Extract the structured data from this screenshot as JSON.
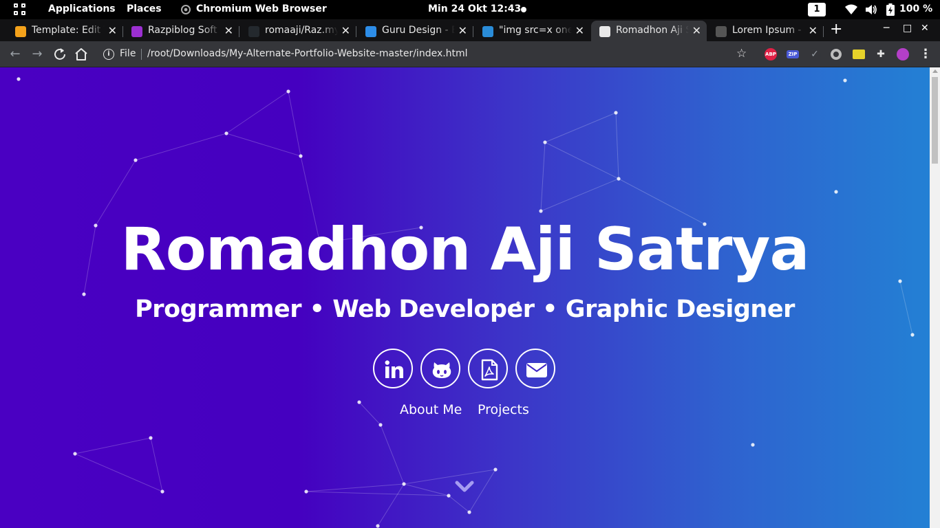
{
  "system_bar": {
    "applications_label": "Applications",
    "places_label": "Places",
    "active_app_label": "Chromium Web Browser",
    "datetime": "Min 24 Okt  12:43",
    "workspace_number": "1",
    "battery_text": "100 %"
  },
  "tabs": [
    {
      "title": "Template: Edit T",
      "favicon_color": "#f4a21b",
      "icon": "blogger-favicon"
    },
    {
      "title": "Razpiblog Soft |",
      "favicon_color": "#9b2fd0",
      "icon": "razpiblog-favicon"
    },
    {
      "title": "romaaji/Raz.my",
      "favicon_color": "#24292e",
      "icon": "github-favicon"
    },
    {
      "title": "Guru Design - B",
      "favicon_color": "#2d8de8",
      "icon": "guru-design-favicon"
    },
    {
      "title": "\"img src=x onerr",
      "favicon_color": "#2a8cd8",
      "icon": "ibb-favicon"
    },
    {
      "title": "Romadhon Aji S",
      "favicon_color": "#e8e8e8",
      "icon": "portfolio-favicon"
    },
    {
      "title": "Lorem Ipsum - A",
      "favicon_color": "#555555",
      "icon": "lorem-ipsum-favicon"
    }
  ],
  "active_tab_index": 5,
  "toolbar": {
    "scheme_label": "File",
    "url": "/root/Downloads/My-Alternate-Portfolio-Website-master/index.html"
  },
  "extensions": [
    {
      "name": "adblock-plus-icon",
      "label": "ABP",
      "color": "#e02045"
    },
    {
      "name": "zip-extension-icon",
      "label": "ZIP",
      "color": "#4b5ad6"
    },
    {
      "name": "checkmark-extension-icon",
      "label": "✓",
      "color": "#35363a"
    },
    {
      "name": "circle-extension-icon",
      "label": "",
      "color": "#bdbdbd"
    },
    {
      "name": "yellow-extension-icon",
      "label": "",
      "color": "#e6d22a"
    },
    {
      "name": "puzzle-extensions-icon",
      "label": "",
      "color": "#35363a"
    },
    {
      "name": "profile-avatar-icon",
      "label": "",
      "color": "#b43fc8"
    }
  ],
  "hero": {
    "name": "Romadhon Aji Satrya",
    "roles": "Programmer • Web Developer • Graphic Designer",
    "socials": [
      {
        "icon": "linkedin-icon"
      },
      {
        "icon": "github-icon"
      },
      {
        "icon": "pdf-resume-icon"
      },
      {
        "icon": "email-icon"
      }
    ],
    "nav_links": [
      "About Me",
      "Projects"
    ]
  },
  "colors": {
    "gradient_left": "#4a00c2",
    "gradient_right": "#2380d4",
    "text": "#ffffff"
  }
}
